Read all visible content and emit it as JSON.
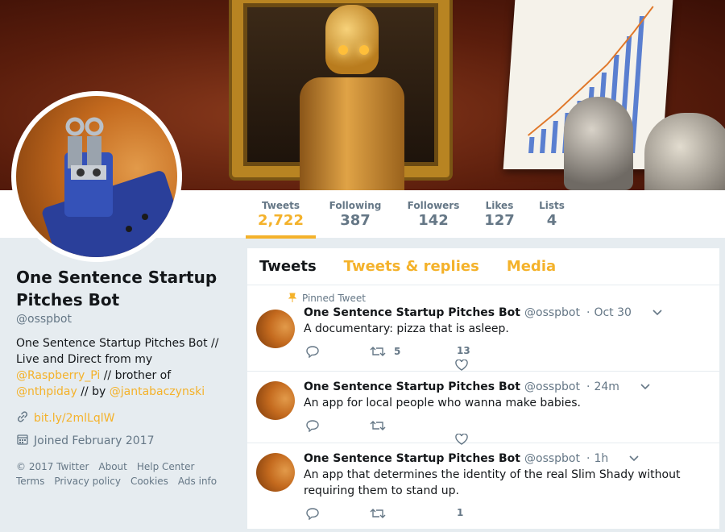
{
  "colors": {
    "accent": "#f4b22b",
    "muted": "#657786",
    "text": "#14171a"
  },
  "nav": {
    "stats": [
      {
        "label": "Tweets",
        "value": "2,722"
      },
      {
        "label": "Following",
        "value": "387"
      },
      {
        "label": "Followers",
        "value": "142"
      },
      {
        "label": "Likes",
        "value": "127"
      },
      {
        "label": "Lists",
        "value": "4"
      }
    ]
  },
  "profile": {
    "name": "One Sentence Startup Pitches Bot",
    "handle": "@osspbot",
    "bio_part1": "One Sentence Startup Pitches Bot // Live and Direct from my ",
    "bio_link1": "@Raspberry_Pi",
    "bio_part2": " // brother of ",
    "bio_link2": "@nthpiday",
    "bio_part3": " // by ",
    "bio_link3": "@jantabaczynski",
    "website": "bit.ly/2mlLqlW",
    "joined": "Joined February 2017",
    "website_icon": "link-icon",
    "joined_icon": "calendar-icon"
  },
  "footer": {
    "copyright": "© 2017 Twitter",
    "about": "About",
    "help": "Help Center",
    "terms": "Terms",
    "privacy": "Privacy policy",
    "cookies": "Cookies",
    "ads": "Ads info"
  },
  "tabs": {
    "tweets": "Tweets",
    "replies": "Tweets & replies",
    "media": "Media"
  },
  "tweets": [
    {
      "pinned_label": "Pinned Tweet",
      "name": "One Sentence Startup Pitches Bot",
      "handle": "@osspbot",
      "time": "Oct 30",
      "text": "A documentary: pizza that is asleep.",
      "retweets": "5",
      "likes": "13"
    },
    {
      "name": "One Sentence Startup Pitches Bot",
      "handle": "@osspbot",
      "time": "24m",
      "text": "An app for local people who wanna make babies.",
      "retweets": "",
      "likes": ""
    },
    {
      "name": "One Sentence Startup Pitches Bot",
      "handle": "@osspbot",
      "time": "1h",
      "text": "An app that determines the identity of the real Slim Shady without requiring them to stand up.",
      "retweets": "",
      "likes": "1"
    }
  ]
}
